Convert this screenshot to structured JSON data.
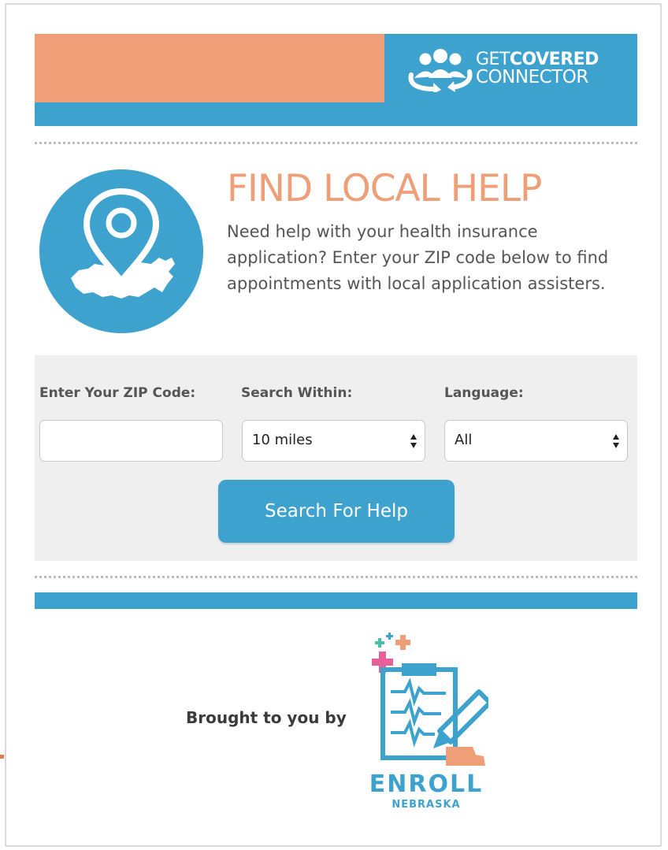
{
  "header": {
    "brand_line1_part1": "GET",
    "brand_line1_part2": "COVERED",
    "brand_line2": "CONNECTOR",
    "logo_icon": "people-group-icon"
  },
  "intro": {
    "title": "FIND LOCAL HELP",
    "description": "Need help with your health insurance application? Enter your ZIP code below to find appointments with local application assisters.",
    "icon": "map-pin-icon"
  },
  "search": {
    "zip_label": "Enter Your ZIP Code:",
    "zip_value": "",
    "within_label": "Search Within:",
    "within_value": "10 miles",
    "language_label": "Language:",
    "language_value": "All",
    "button_label": "Search For Help"
  },
  "footer": {
    "brought_by": "Brought to you by",
    "partner_word1": "ENROLL",
    "partner_word2": "NEBRASKA"
  },
  "colors": {
    "accent_blue": "#3ea2cf",
    "accent_orange": "#ee9f78",
    "panel_gray": "#efefef"
  }
}
